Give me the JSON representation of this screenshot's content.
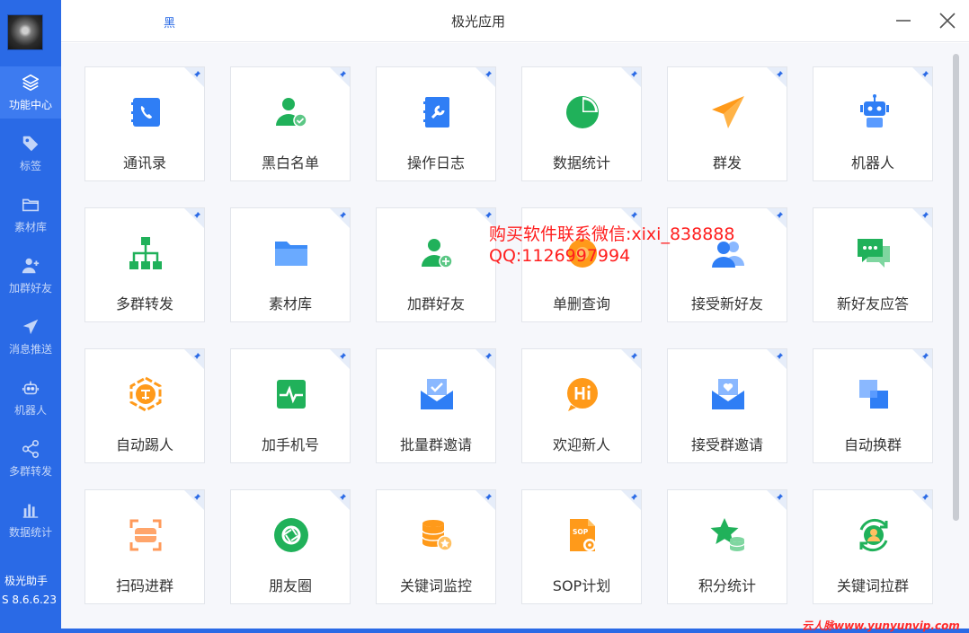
{
  "sidebar": {
    "items": [
      {
        "label": "功能中心",
        "icon": "layers-icon"
      },
      {
        "label": "标签",
        "icon": "tag-icon"
      },
      {
        "label": "素材库",
        "icon": "folder-icon"
      },
      {
        "label": "加群好友",
        "icon": "add-user-icon"
      },
      {
        "label": "消息推送",
        "icon": "send-icon"
      },
      {
        "label": "机器人",
        "icon": "robot-icon"
      },
      {
        "label": "多群转发",
        "icon": "share-icon"
      },
      {
        "label": "数据统计",
        "icon": "bar-chart-icon"
      }
    ],
    "brand": "极光助手",
    "version": "S 8.6.6.23"
  },
  "titlebar": {
    "small_text": "黑",
    "title": "极光应用"
  },
  "tiles": [
    {
      "label": "通讯录",
      "icon": "contacts-icon"
    },
    {
      "label": "黑白名单",
      "icon": "user-check-icon"
    },
    {
      "label": "操作日志",
      "icon": "log-icon"
    },
    {
      "label": "数据统计",
      "icon": "pie-chart-icon"
    },
    {
      "label": "群发",
      "icon": "send-icon"
    },
    {
      "label": "机器人",
      "icon": "robot-icon"
    },
    {
      "label": "多群转发",
      "icon": "hierarchy-icon"
    },
    {
      "label": "素材库",
      "icon": "folder-icon"
    },
    {
      "label": "加群好友",
      "icon": "user-plus-icon"
    },
    {
      "label": "单删查询",
      "icon": "search-gear-icon"
    },
    {
      "label": "接受新好友",
      "icon": "users-icon"
    },
    {
      "label": "新好友应答",
      "icon": "chat-icon"
    },
    {
      "label": "自动踢人",
      "icon": "kick-icon"
    },
    {
      "label": "加手机号",
      "icon": "pulse-icon"
    },
    {
      "label": "批量群邀请",
      "icon": "mail-check-icon"
    },
    {
      "label": "欢迎新人",
      "icon": "hi-bubble-icon"
    },
    {
      "label": "接受群邀请",
      "icon": "mail-heart-icon"
    },
    {
      "label": "自动换群",
      "icon": "swap-squares-icon"
    },
    {
      "label": "扫码进群",
      "icon": "scan-icon"
    },
    {
      "label": "朋友圈",
      "icon": "aperture-icon"
    },
    {
      "label": "关键词监控",
      "icon": "database-icon"
    },
    {
      "label": "SOP计划",
      "icon": "sop-file-icon"
    },
    {
      "label": "积分统计",
      "icon": "star-coins-icon"
    },
    {
      "label": "关键词拉群",
      "icon": "user-refresh-icon"
    }
  ],
  "overlay": {
    "line1": "购买软件联系微信:xixi_838888",
    "line2": "QQ:1126997994"
  },
  "watermark": "云人脉www.yunyunvip.com",
  "colors": {
    "sidebar": "#2a6ae6",
    "sidebar_active": "#3d7bf0",
    "accent_blue": "#2f7ef5",
    "accent_green": "#20b15a",
    "accent_orange": "#ff9a1a",
    "overlay_red": "#ff1e1e"
  }
}
